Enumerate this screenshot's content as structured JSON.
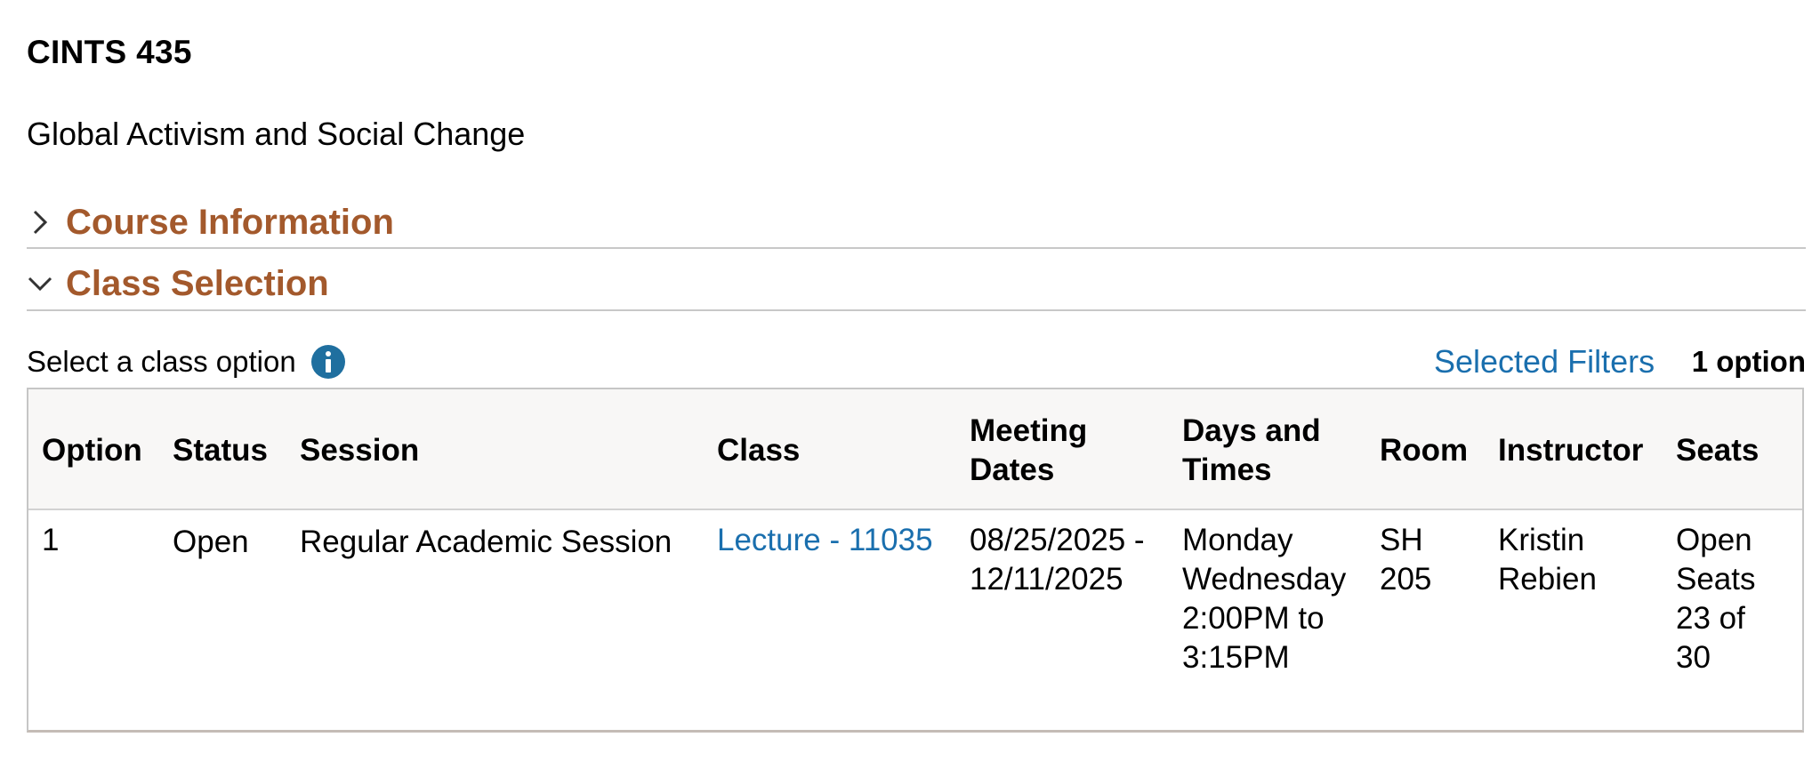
{
  "course": {
    "code": "CINTS 435",
    "title": "Global Activism and Social Change"
  },
  "sections": {
    "course_information": "Course Information",
    "class_selection": "Class Selection"
  },
  "class_options": {
    "prompt": "Select a class option",
    "filters_link": "Selected Filters",
    "count": "1 option"
  },
  "table": {
    "headers": {
      "option": "Option",
      "status": "Status",
      "session": "Session",
      "class": "Class",
      "meeting_dates_1": "Meeting",
      "meeting_dates_2": "Dates",
      "days_times_1": "Days and",
      "days_times_2": "Times",
      "room": "Room",
      "instructor": "Instructor",
      "seats": "Seats"
    },
    "rows": [
      {
        "option": "1",
        "status": "Open",
        "session": "Regular Academic Session",
        "class": "Lecture - 11035",
        "meeting_dates_1": "08/25/2025 -",
        "meeting_dates_2": "12/11/2025",
        "days_1": "Monday",
        "days_2": "Wednesday",
        "times_1": "2:00PM to",
        "times_2": "3:15PM",
        "room_1": "SH",
        "room_2": "205",
        "instructor_1": "Kristin",
        "instructor_2": "Rebien",
        "seats_1": "Open",
        "seats_2": "Seats",
        "seats_3": "23 of",
        "seats_4": "30"
      }
    ]
  },
  "colors": {
    "section_header": "#a3592c",
    "link": "#1a6fae",
    "info_icon": "#1f6f9f"
  },
  "icons": {
    "collapsed": "chevron-right-icon",
    "expanded": "chevron-down-icon",
    "info": "info-icon"
  }
}
